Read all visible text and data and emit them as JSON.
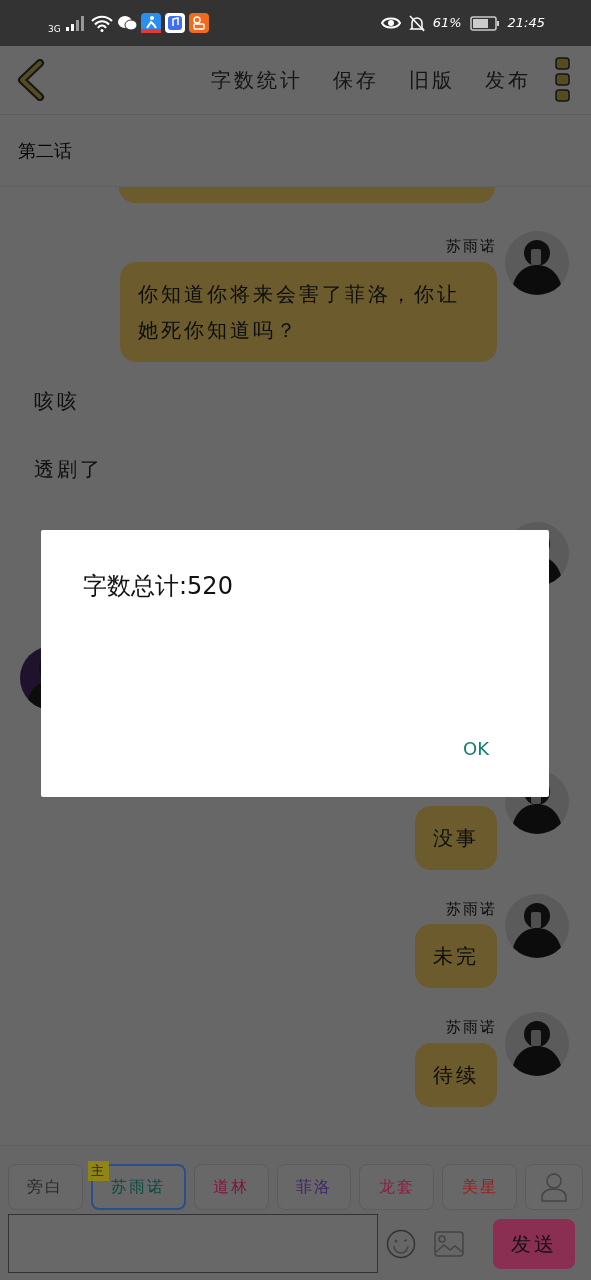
{
  "status_bar": {
    "network": "3G",
    "battery": "61%",
    "time": "21:45"
  },
  "toolbar": {
    "actions": [
      "字数统计",
      "保存",
      "旧版",
      "发布"
    ]
  },
  "chapter_title": "第二话",
  "messages": [
    {
      "kind": "partial"
    },
    {
      "kind": "message",
      "speaker": "苏雨诺",
      "text": "你知道你将来会害了菲洛，你让她死你知道吗？"
    },
    {
      "kind": "narration",
      "text": "咳咳"
    },
    {
      "kind": "narration",
      "text": "透剧了"
    },
    {
      "kind": "own_avatar"
    },
    {
      "kind": "other_avatar"
    },
    {
      "kind": "message",
      "text": "没事"
    },
    {
      "kind": "message",
      "speaker": "苏雨诺",
      "text": "未完"
    },
    {
      "kind": "message",
      "speaker": "苏雨诺",
      "text": "待续"
    }
  ],
  "characters": [
    {
      "label": "旁白",
      "color": "#2a2a2a",
      "selected": false
    },
    {
      "label": "苏雨诺",
      "color": "#0e4a40",
      "selected": true,
      "badge": "主"
    },
    {
      "label": "道林",
      "color": "#7e1440",
      "selected": false
    },
    {
      "label": "菲洛",
      "color": "#3e2466",
      "selected": false
    },
    {
      "label": "龙套",
      "color": "#931a42",
      "selected": false
    },
    {
      "label": "美星",
      "color": "#9a1e1e",
      "selected": false
    }
  ],
  "send_button": "发送",
  "dialog": {
    "message": "字数总计:520",
    "button": "OK"
  }
}
